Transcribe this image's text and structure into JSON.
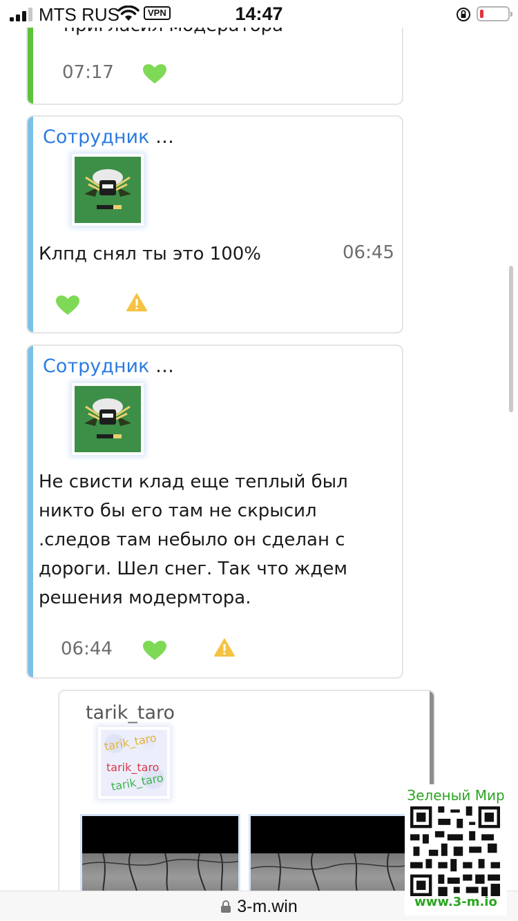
{
  "status_bar": {
    "carrier": "MTS RUS",
    "vpn": "VPN",
    "time": "14:47"
  },
  "messages": [
    {
      "text": "пригласил модератора",
      "time": "07:17"
    },
    {
      "author": "Сотрудник",
      "ellipsis": "…",
      "text": "Клпд снял ты это 100%",
      "time": "06:45"
    },
    {
      "author": "Сотрудник",
      "ellipsis": "…",
      "text_lines": [
        "Не свисти клад еще теплый был",
        "никто бы его там не скрысил",
        ".следов там небыло он сделан с",
        "дороги. Шел снег. Так что ждем",
        "решения модермтора."
      ],
      "time": "06:44"
    },
    {
      "author": "tarik_taro"
    }
  ],
  "browser": {
    "url": "3-m.win"
  },
  "watermark": {
    "title": "Зеленый Мир",
    "url": "www.3-m.io"
  },
  "icons": {
    "like": "heart-icon",
    "report": "warning-icon",
    "lock": "lock-icon"
  },
  "colors": {
    "author_link": "#2b7be0",
    "accent_green": "#5cc23a",
    "accent_blue": "#7cc0e8",
    "heart": "#7ed957",
    "warning": "#f5c242"
  }
}
